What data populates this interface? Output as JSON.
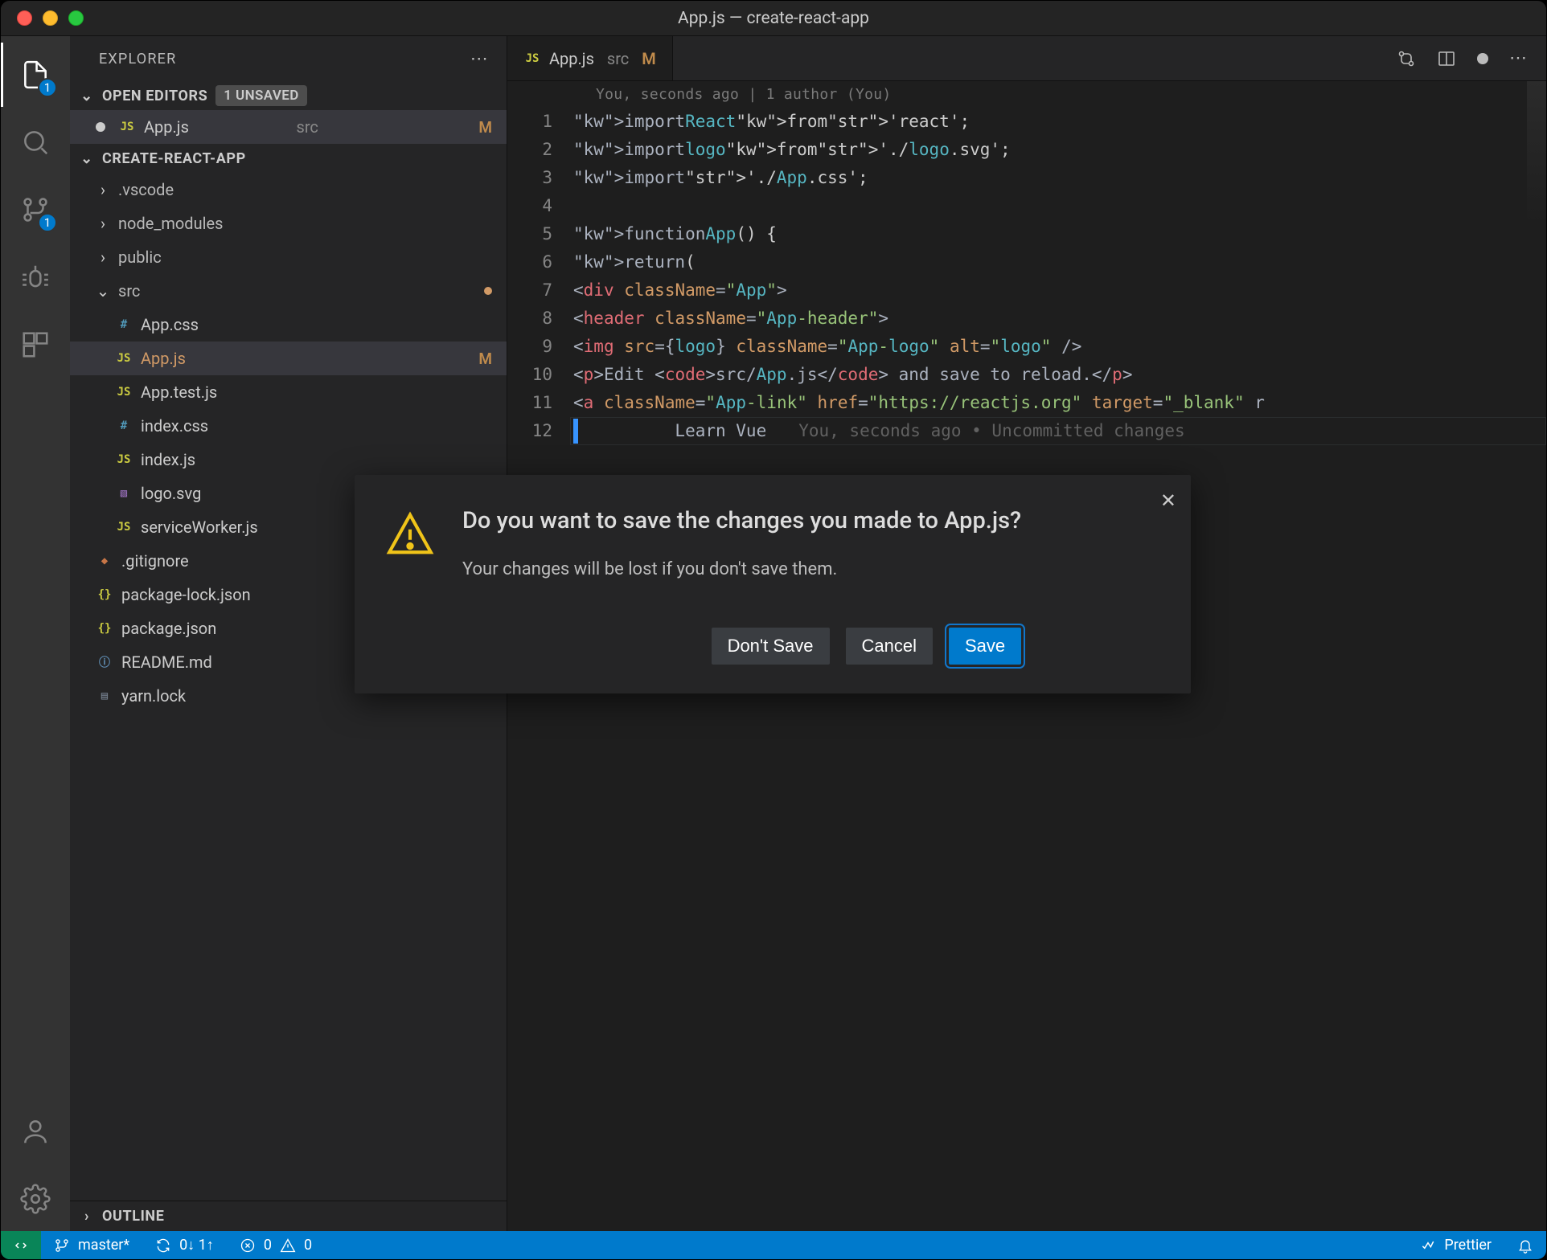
{
  "window": {
    "title": "App.js — create-react-app"
  },
  "sidebar": {
    "title": "EXPLORER",
    "openEditors": {
      "header": "OPEN EDITORS",
      "badge": "1 UNSAVED",
      "items": [
        {
          "icon": "js",
          "name": "App.js",
          "dir": "src",
          "status": "M",
          "dirty": true
        }
      ]
    },
    "project": {
      "header": "CREATE-REACT-APP",
      "tree": [
        {
          "kind": "folder",
          "name": ".vscode",
          "depth": 1
        },
        {
          "kind": "folder",
          "name": "node_modules",
          "depth": 1
        },
        {
          "kind": "folder",
          "name": "public",
          "depth": 1
        },
        {
          "kind": "folder",
          "name": "src",
          "depth": 1,
          "open": true,
          "gitdot": true
        },
        {
          "kind": "file",
          "icon": "css",
          "name": "App.css",
          "depth": 2
        },
        {
          "kind": "file",
          "icon": "js",
          "name": "App.js",
          "depth": 2,
          "status": "M",
          "selected": true,
          "git": "modified"
        },
        {
          "kind": "file",
          "icon": "js",
          "name": "App.test.js",
          "depth": 2
        },
        {
          "kind": "file",
          "icon": "css",
          "name": "index.css",
          "depth": 2
        },
        {
          "kind": "file",
          "icon": "js",
          "name": "index.js",
          "depth": 2
        },
        {
          "kind": "file",
          "icon": "svg",
          "name": "logo.svg",
          "depth": 2
        },
        {
          "kind": "file",
          "icon": "js",
          "name": "serviceWorker.js",
          "depth": 2
        },
        {
          "kind": "file",
          "icon": "git",
          "name": ".gitignore",
          "depth": 1
        },
        {
          "kind": "file",
          "icon": "json",
          "name": "package-lock.json",
          "depth": 1
        },
        {
          "kind": "file",
          "icon": "json",
          "name": "package.json",
          "depth": 1
        },
        {
          "kind": "file",
          "icon": "md",
          "name": "README.md",
          "depth": 1
        },
        {
          "kind": "file",
          "icon": "lock",
          "name": "yarn.lock",
          "depth": 1
        }
      ]
    },
    "outline": {
      "header": "OUTLINE"
    }
  },
  "activity": {
    "explorer_badge": "1",
    "scm_badge": "1"
  },
  "editor": {
    "tab": {
      "icon": "js",
      "name": "App.js",
      "dir": "src",
      "status": "M"
    },
    "blame": "You, seconds ago | 1 author (You)",
    "inlineBlame": "You, seconds ago • Uncommitted changes",
    "lines": [
      "import React from 'react';",
      "import logo from './logo.svg';",
      "import './App.css';",
      "",
      "function App() {",
      "  return (",
      "    <div className=\"App\">",
      "      <header className=\"App-header\">",
      "        <img src={logo} className=\"App-logo\" alt=\"logo\" />",
      "        <p>Edit <code>src/App.js</code> and save to reload.</p>",
      "        <a className=\"App-link\" href=\"https://reactjs.org\" target=\"_blank\" r",
      "          Learn Vue"
    ]
  },
  "status": {
    "branch": "master*",
    "sync": "0↓ 1↑",
    "errors": "0",
    "warnings": "0",
    "prettier": "Prettier"
  },
  "modal": {
    "title": "Do you want to save the changes you made to App.js?",
    "body": "Your changes will be lost if you don't save them.",
    "buttons": {
      "dontSave": "Don't Save",
      "cancel": "Cancel",
      "save": "Save"
    }
  }
}
